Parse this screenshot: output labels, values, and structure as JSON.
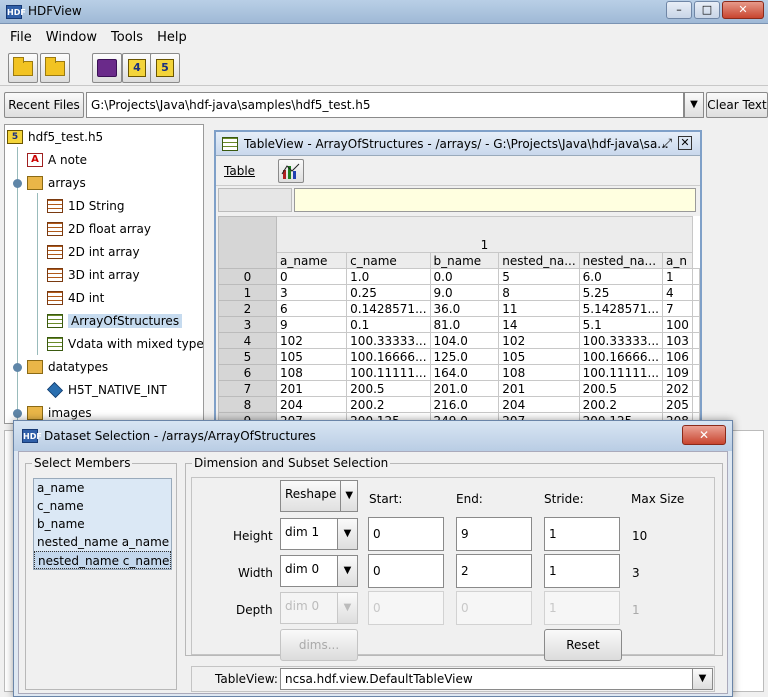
{
  "app": {
    "title": "HDFView",
    "menu": [
      "File",
      "Window",
      "Tools",
      "Help"
    ],
    "recent_label": "Recent Files",
    "recent_path": "G:\\Projects\\Java\\hdf-java\\samples\\hdf5_test.h5",
    "clear_text": "Clear Text"
  },
  "tree": {
    "root": "hdf5_test.h5",
    "items": [
      {
        "label": "A note",
        "icon": "note-icon"
      },
      {
        "label": "arrays",
        "icon": "folder-icon"
      },
      {
        "label": "1D String",
        "icon": "dataset-icon"
      },
      {
        "label": "2D float array",
        "icon": "dataset-icon"
      },
      {
        "label": "2D int array",
        "icon": "dataset-icon"
      },
      {
        "label": "3D int array",
        "icon": "dataset-icon"
      },
      {
        "label": "4D int",
        "icon": "dataset-icon"
      },
      {
        "label": "ArrayOfStructures",
        "icon": "table-icon"
      },
      {
        "label": "Vdata with mixed types",
        "icon": "table-icon"
      },
      {
        "label": "datatypes",
        "icon": "folder-icon"
      },
      {
        "label": "H5T_NATIVE_INT",
        "icon": "datatype-icon"
      },
      {
        "label": "images",
        "icon": "folder-icon"
      }
    ]
  },
  "tableview": {
    "title": "TableView  -  ArrayOfStructures  -  /arrays/  -  G:\\Projects\\Java\\hdf-java\\sa...",
    "menu_table": "Table",
    "group_header": "1",
    "columns": [
      "a_name",
      "c_name",
      "b_name",
      "nested_na...",
      "nested_na...",
      "a_n"
    ],
    "rows": [
      {
        "idx": "0",
        "cells": [
          "0",
          "1.0",
          "0.0",
          "5",
          "6.0",
          "1"
        ]
      },
      {
        "idx": "1",
        "cells": [
          "3",
          "0.25",
          "9.0",
          "8",
          "5.25",
          "4"
        ]
      },
      {
        "idx": "2",
        "cells": [
          "6",
          "0.1428571...",
          "36.0",
          "11",
          "5.1428571...",
          "7"
        ]
      },
      {
        "idx": "3",
        "cells": [
          "9",
          "0.1",
          "81.0",
          "14",
          "5.1",
          "100"
        ]
      },
      {
        "idx": "4",
        "cells": [
          "102",
          "100.33333...",
          "104.0",
          "102",
          "100.33333...",
          "103"
        ]
      },
      {
        "idx": "5",
        "cells": [
          "105",
          "100.16666...",
          "125.0",
          "105",
          "100.16666...",
          "106"
        ]
      },
      {
        "idx": "6",
        "cells": [
          "108",
          "100.11111...",
          "164.0",
          "108",
          "100.11111...",
          "109"
        ]
      },
      {
        "idx": "7",
        "cells": [
          "201",
          "200.5",
          "201.0",
          "201",
          "200.5",
          "202"
        ]
      },
      {
        "idx": "8",
        "cells": [
          "204",
          "200.2",
          "216.0",
          "204",
          "200.2",
          "205"
        ]
      },
      {
        "idx": "9",
        "cells": [
          "207",
          "200.125",
          "249.0",
          "207",
          "200.125",
          "208"
        ]
      }
    ]
  },
  "dialog": {
    "title": "Dataset Selection - /arrays/ArrayOfStructures",
    "select_members_label": "Select Members",
    "members": [
      "a_name",
      "c_name",
      "b_name",
      "nested_name  a_name",
      "nested_name  c_name"
    ],
    "dimension_label": "Dimension and Subset Selection",
    "reshape": "Reshape",
    "col_start": "Start:",
    "col_end": "End:",
    "col_stride": "Stride:",
    "col_max": "Max Size",
    "height_label": "Height",
    "width_label": "Width",
    "depth_label": "Depth",
    "height": {
      "dim": "dim 1",
      "start": "0",
      "end": "9",
      "stride": "1",
      "max": "10"
    },
    "width": {
      "dim": "dim 0",
      "start": "0",
      "end": "2",
      "stride": "1",
      "max": "3"
    },
    "depth": {
      "dim": "dim 0",
      "start": "0",
      "end": "0",
      "stride": "1",
      "max": "1"
    },
    "dims_button": "dims...",
    "reset_button": "Reset",
    "tableview_label": "TableView:",
    "tableview_value": "ncsa.hdf.view.DefaultTableView"
  }
}
